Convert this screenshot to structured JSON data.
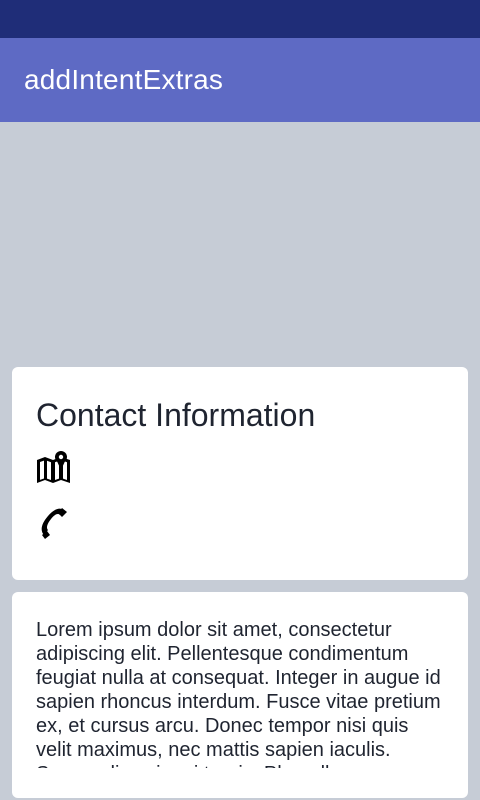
{
  "app_bar": {
    "title": "addIntentExtras"
  },
  "contact_card": {
    "title": "Contact Information",
    "icons": [
      "map-icon",
      "phone-icon"
    ]
  },
  "description_card": {
    "text": "Lorem ipsum dolor sit amet, consectetur adipiscing elit. Pellentesque condimentum feugiat nulla at consequat. Integer in augue id sapien rhoncus interdum. Fusce vitae pretium ex, et cursus arcu. Donec tempor nisi quis velit maximus, nec mattis sapien iaculis. Suspendisse in mi turpis. Phasellus"
  }
}
